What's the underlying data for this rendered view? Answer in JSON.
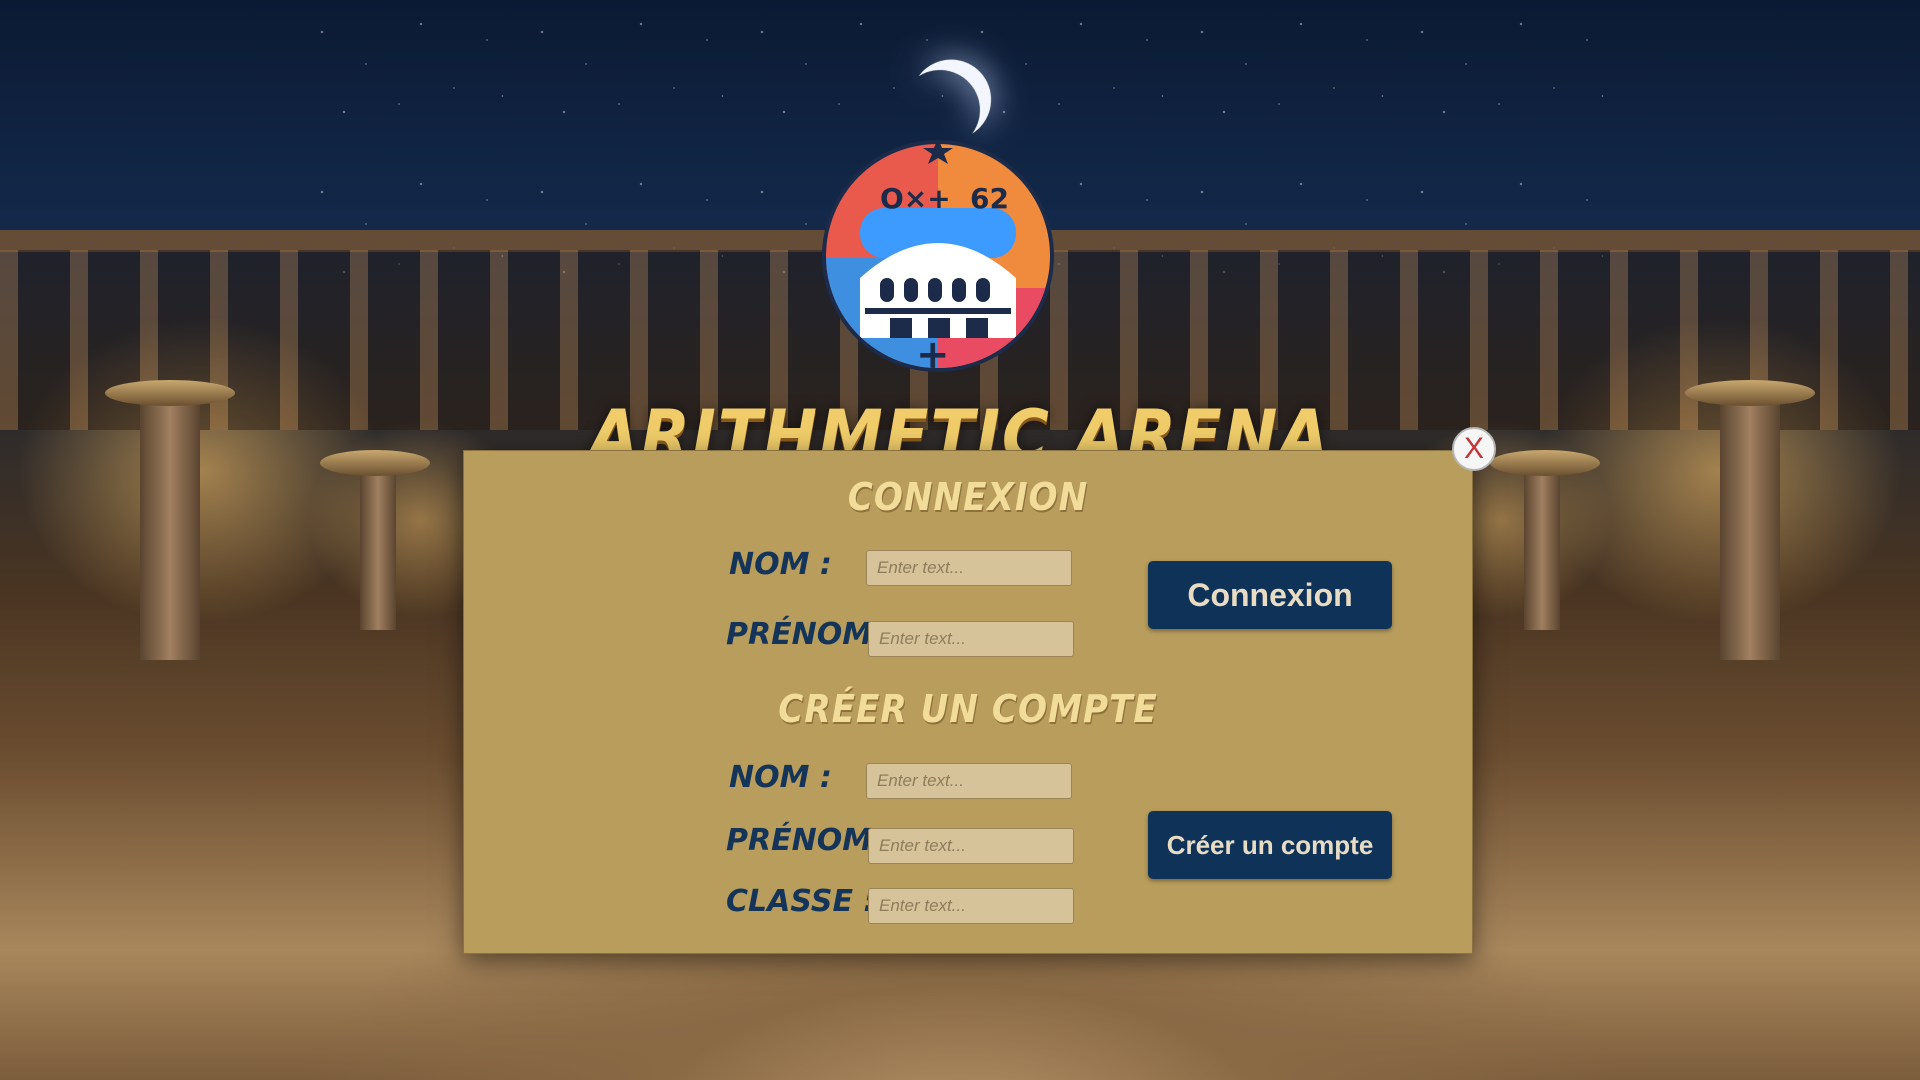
{
  "game": {
    "title": "ARITHMETIC ARENA"
  },
  "login": {
    "title": "CONNEXION",
    "nom_label": "NOM :",
    "prenom_label": "PRÉNOM :",
    "nom_placeholder": "Enter text...",
    "prenom_placeholder": "Enter text...",
    "button": "Connexion"
  },
  "register": {
    "title": "CRÉER UN COMPTE",
    "nom_label": "NOM :",
    "prenom_label": "PRÉNOM :",
    "classe_label": "CLASSE :",
    "nom_placeholder": "Enter text...",
    "prenom_placeholder": "Enter text...",
    "classe_placeholder": "Enter text...",
    "button": "Créer un compte"
  },
  "close": {
    "label": "X"
  },
  "colors": {
    "panel": "#b89d5c",
    "label": "#143559",
    "title": "#f2dc9a",
    "button": "#0f3358",
    "close": "#c03636"
  }
}
